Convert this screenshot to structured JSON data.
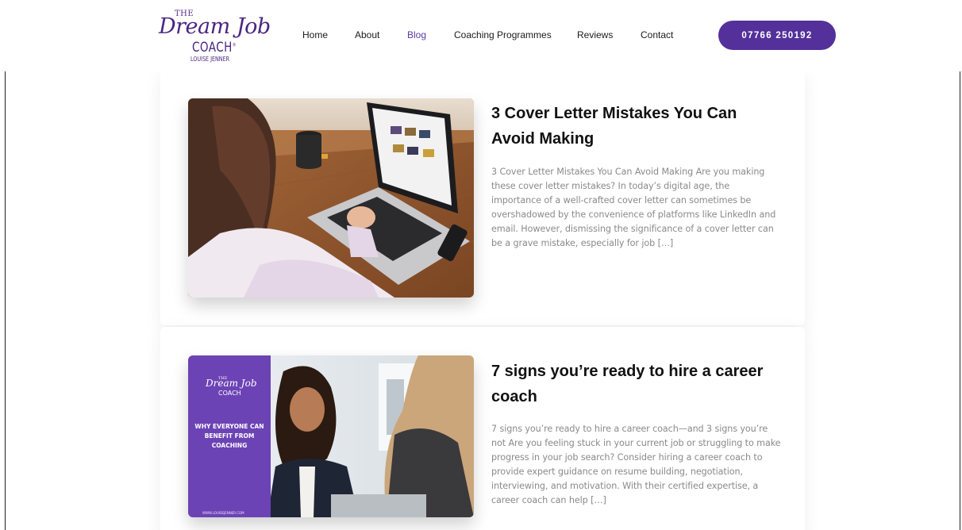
{
  "brand": {
    "logo_the": "THE",
    "logo_script": "Dream Job",
    "logo_coach": "COACH",
    "logo_name": "LOUISE JENNER",
    "accent_color": "#54309b"
  },
  "nav": {
    "items": [
      {
        "label": "Home"
      },
      {
        "label": "About"
      },
      {
        "label": "Blog",
        "active": true
      },
      {
        "label": "Coaching Programmes"
      },
      {
        "label": "Reviews"
      },
      {
        "label": "Contact"
      }
    ],
    "phone_button": "07766 250192"
  },
  "posts": [
    {
      "title": "3 Cover Letter Mistakes You Can Avoid Making",
      "excerpt": "3 Cover Letter Mistakes You Can Avoid Making Are you making these cover letter mistakes? In today’s digital age, the importance of a well-crafted cover letter can sometimes be overshadowed by the convenience of platforms like LinkedIn and email. However, dismissing the significance of a cover letter can be a grave mistake, especially for job […]",
      "image": "woman-using-laptop-photo"
    },
    {
      "title": "7 signs you’re ready to hire a career coach",
      "excerpt": "7 signs you’re ready to hire a career coach—and 3 signs you’re not Are you feeling stuck in your current job or struggling to make progress in your job search? Consider hiring a career coach to provide expert guidance on resume building, negotiation, interviewing, and motivation. With their certified expertise, a career coach can help […]",
      "image": "coaching-session-photo",
      "promo": {
        "the": "THE",
        "script": "Dream Job",
        "coach": "COACH",
        "headline": "WHY EVERYONE CAN BENEFIT FROM COACHING",
        "url": "WWW.LOUISEJENNER.COM"
      }
    }
  ]
}
